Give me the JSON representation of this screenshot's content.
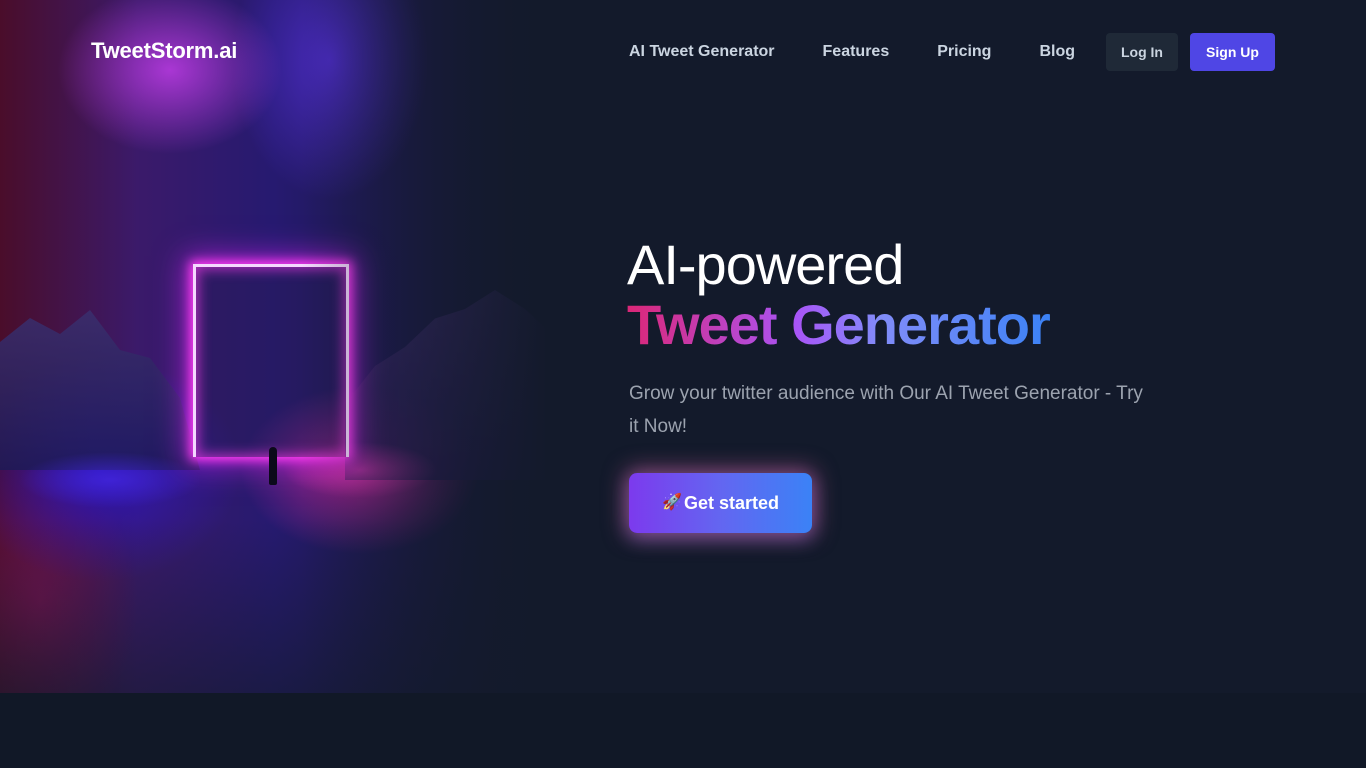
{
  "brand": {
    "name": "TweetStorm.ai"
  },
  "nav": {
    "links": [
      "AI Tweet Generator",
      "Features",
      "Pricing",
      "Blog"
    ],
    "login_label": "Log In",
    "signup_label": "Sign Up"
  },
  "hero": {
    "headline_line1": "AI-powered",
    "headline_line2": "Tweet Generator",
    "subtitle": "Grow your twitter audience with Our AI Tweet Generator - Try it Now!",
    "cta_icon": "🚀",
    "cta_label": "Get started",
    "image": "neon-portal-illustration"
  },
  "colors": {
    "background": "#131a2b",
    "signup_button": "#4f46e5",
    "login_button": "#1f2937",
    "gradient_pink": "#db2777",
    "gradient_blue": "#3b82f6"
  }
}
